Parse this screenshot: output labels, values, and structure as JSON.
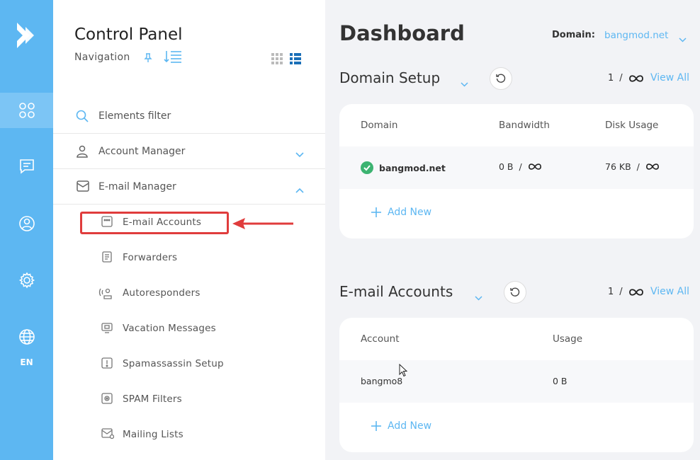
{
  "rail": {
    "language": "EN",
    "items": [
      "dashboard-icon",
      "messages-icon",
      "account-icon",
      "settings-icon",
      "globe-icon"
    ],
    "accent_color": "#5db7f2"
  },
  "nav": {
    "title": "Control Panel",
    "subtitle": "Navigation",
    "filter_placeholder": "Elements filter",
    "sections": [
      {
        "label": "Account Manager",
        "expanded": false
      },
      {
        "label": "E-mail Manager",
        "expanded": true
      }
    ],
    "email_items": [
      "E-mail Accounts",
      "Forwarders",
      "Autoresponders",
      "Vacation Messages",
      "Spamassassin Setup",
      "SPAM Filters",
      "Mailing Lists"
    ]
  },
  "main": {
    "title": "Dashboard",
    "domain_label": "Domain:",
    "domain_value": "bangmod.net",
    "domain_setup": {
      "title": "Domain Setup",
      "count": "1",
      "sep": "/",
      "view_all": "View All",
      "headers": [
        "Domain",
        "Bandwidth",
        "Disk Usage"
      ],
      "rows": [
        {
          "domain": "bangmod.net",
          "bandwidth": "0 B",
          "disk": "76 KB",
          "sep": "/"
        }
      ],
      "add_new": "Add New"
    },
    "email_accounts": {
      "title": "E-mail Accounts",
      "count": "1",
      "sep": "/",
      "view_all": "View All",
      "headers": [
        "Account",
        "Usage"
      ],
      "rows": [
        {
          "account": "bangmo8",
          "usage": "0 B"
        }
      ],
      "add_new": "Add New"
    }
  }
}
